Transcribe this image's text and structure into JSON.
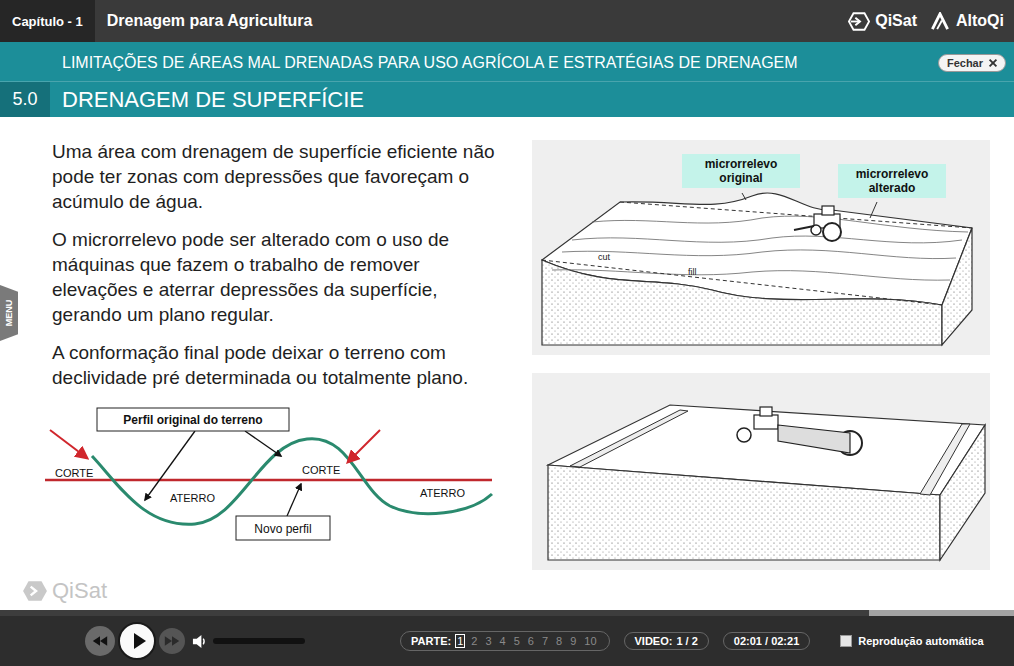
{
  "top_bar": {
    "chapter": "Capítulo - 1",
    "course_title": "Drenagem para Agricultura",
    "brands": [
      {
        "name": "QiSat",
        "kind": "qisat"
      },
      {
        "name": "AltoQi",
        "kind": "altoqi"
      }
    ]
  },
  "section_header": {
    "supertitle": "LIMITAÇÕES DE ÁREAS MAL DRENADAS PARA USO AGRÍCOLA E ESTRATÉGIAS DE DRENAGEM",
    "number": "5.0",
    "title": "DRENAGEM DE SUPERFÍCIE",
    "close_button": "Fechar"
  },
  "side_menu_tab": "MENU",
  "paragraphs": [
    "Uma área com drenagem de superfície eficiente não pode ter zonas com depressões que favoreçam o acúmulo de água.",
    "O microrrelevo pode ser alterado com o uso de máquinas que fazem o trabalho de remover elevações e aterrar depressões da superfície, gerando um plano regular.",
    "A conformação final pode deixar o terreno com declividade pré determinada ou totalmente plano."
  ],
  "profile_diagram": {
    "original_label": "Perfil original do terreno",
    "new_label": "Novo perfil",
    "regions": [
      {
        "label": "CORTE"
      },
      {
        "label": "ATERRO"
      },
      {
        "label": "CORTE"
      },
      {
        "label": "ATERRO"
      }
    ]
  },
  "figures": [
    {
      "kind": "uneven",
      "labels": [
        {
          "text": "microrrelevo original",
          "kind": "callout"
        },
        {
          "text": "microrrelevo alterado",
          "kind": "callout"
        },
        {
          "text": "cut",
          "kind": "tag"
        },
        {
          "text": "fill",
          "kind": "tag"
        }
      ]
    },
    {
      "kind": "leveled",
      "labels": []
    }
  ],
  "watermark": "QiSat",
  "player": {
    "progress": {
      "level": 0.857
    },
    "volume": {
      "level": 1
    },
    "parts_label": "PARTE:",
    "parts": [
      {
        "label": "1",
        "selected": true
      },
      {
        "label": "2",
        "selected": false
      },
      {
        "label": "3",
        "selected": false
      },
      {
        "label": "4",
        "selected": false
      },
      {
        "label": "5",
        "selected": false
      },
      {
        "label": "6",
        "selected": false
      },
      {
        "label": "7",
        "selected": false
      },
      {
        "label": "8",
        "selected": false
      },
      {
        "label": "9",
        "selected": false
      },
      {
        "label": "10",
        "selected": false
      }
    ],
    "video_label": "VIDEO:",
    "video_value": "1 / 2",
    "time": "02:01 / 02:21",
    "autoplay": {
      "label": "Reprodução automática",
      "checked": false
    }
  }
}
